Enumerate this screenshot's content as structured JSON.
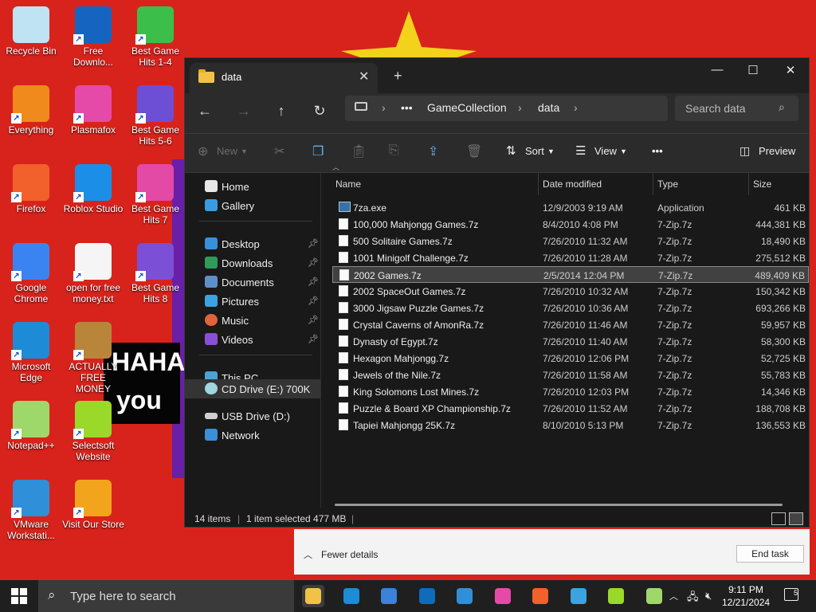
{
  "desktop": {
    "icons": [
      {
        "label": "Recycle Bin",
        "icon": "recycle-bin-icon",
        "color": "#bfe3f2"
      },
      {
        "label": "Free Downlo...",
        "icon": "download-manager-icon",
        "color": "#1565c0"
      },
      {
        "label": "Best Game Hits 1-4",
        "icon": "dice-icon",
        "color": "#3bbf4a"
      },
      {
        "label": "Everything",
        "icon": "magnifier-icon",
        "color": "#f08a1c"
      },
      {
        "label": "Plasmafox",
        "icon": "plasmafox-icon",
        "color": "#e64aa8"
      },
      {
        "label": "Best Game Hits 5-6",
        "icon": "dice-icon",
        "color": "#6d4fd6"
      },
      {
        "label": "Firefox",
        "icon": "firefox-icon",
        "color": "#f2602c"
      },
      {
        "label": "Roblox Studio",
        "icon": "roblox-studio-icon",
        "color": "#1b8fe8"
      },
      {
        "label": "Best Game Hits 7",
        "icon": "dice-icon",
        "color": "#e34aa5"
      },
      {
        "label": "Google Chrome",
        "icon": "chrome-icon",
        "color": "#3a84f2"
      },
      {
        "label": "open for free money.txt",
        "icon": "text-file-icon",
        "color": "#f5f5f5"
      },
      {
        "label": "Best Game Hits 8",
        "icon": "dice-icon",
        "color": "#7b4fd6"
      },
      {
        "label": "Microsoft Edge",
        "icon": "edge-icon",
        "color": "#1d8bd6"
      },
      {
        "label": "ACTUALLY FREE MONEY",
        "icon": "money-bag-icon",
        "color": "#b9853a"
      },
      {
        "label": "Notepad++",
        "icon": "notepad-plus-icon",
        "color": "#9fd86a"
      },
      {
        "label": "Selectsoft Website",
        "icon": "selectsoft-icon",
        "color": "#9ad82a"
      },
      {
        "label": "VMware Workstati...",
        "icon": "vmware-icon",
        "color": "#2f8fd8"
      },
      {
        "label": "Visit Our Store",
        "icon": "store-icon",
        "color": "#f2a51c"
      }
    ],
    "overlay_text": [
      "HAHA",
      "you"
    ]
  },
  "explorer": {
    "tab_title": "data",
    "breadcrumb": [
      "GameCollection",
      "data"
    ],
    "search_placeholder": "Search data",
    "toolbar": {
      "new": "New",
      "sort": "Sort",
      "view": "View",
      "more": "•••",
      "preview": "Preview"
    },
    "sidebar": {
      "home": "Home",
      "gallery": "Gallery",
      "desktop": "Desktop",
      "downloads": "Downloads",
      "documents": "Documents",
      "pictures": "Pictures",
      "music": "Music",
      "videos": "Videos",
      "this_pc": "This PC",
      "cd_drive": "CD Drive (E:) 700K",
      "usb_drive": "USB Drive (D:)",
      "network": "Network"
    },
    "columns": {
      "name": "Name",
      "date": "Date modified",
      "type": "Type",
      "size": "Size"
    },
    "files": [
      {
        "name": "7za.exe",
        "date": "12/9/2003 9:19 AM",
        "type": "Application",
        "size": "461 KB"
      },
      {
        "name": "100,000 Mahjongg Games.7z",
        "date": "8/4/2010 4:08 PM",
        "type": "7-Zip.7z",
        "size": "444,381 KB"
      },
      {
        "name": "500 Solitaire Games.7z",
        "date": "7/26/2010 11:32 AM",
        "type": "7-Zip.7z",
        "size": "18,490 KB"
      },
      {
        "name": "1001 Minigolf Challenge.7z",
        "date": "7/26/2010 11:28 AM",
        "type": "7-Zip.7z",
        "size": "275,512 KB"
      },
      {
        "name": "2002 Games.7z",
        "date": "2/5/2014 12:04 PM",
        "type": "7-Zip.7z",
        "size": "489,409 KB"
      },
      {
        "name": "2002 SpaceOut Games.7z",
        "date": "7/26/2010 10:32 AM",
        "type": "7-Zip.7z",
        "size": "150,342 KB"
      },
      {
        "name": "3000 Jigsaw Puzzle Games.7z",
        "date": "7/26/2010 10:36 AM",
        "type": "7-Zip.7z",
        "size": "693,266 KB"
      },
      {
        "name": "Crystal Caverns of AmonRa.7z",
        "date": "7/26/2010 11:46 AM",
        "type": "7-Zip.7z",
        "size": "59,957 KB"
      },
      {
        "name": "Dynasty of Egypt.7z",
        "date": "7/26/2010 11:40 AM",
        "type": "7-Zip.7z",
        "size": "58,300 KB"
      },
      {
        "name": "Hexagon Mahjongg.7z",
        "date": "7/26/2010 12:06 PM",
        "type": "7-Zip.7z",
        "size": "52,725 KB"
      },
      {
        "name": "Jewels of the Nile.7z",
        "date": "7/26/2010 11:58 AM",
        "type": "7-Zip.7z",
        "size": "55,783 KB"
      },
      {
        "name": "King Solomons Lost Mines.7z",
        "date": "7/26/2010 12:03 PM",
        "type": "7-Zip.7z",
        "size": "14,346 KB"
      },
      {
        "name": "Puzzle & Board XP Championship.7z",
        "date": "7/26/2010 11:52 AM",
        "type": "7-Zip.7z",
        "size": "188,708 KB"
      },
      {
        "name": "Tapiei Mahjongg 25K.7z",
        "date": "8/10/2010 5:13 PM",
        "type": "7-Zip.7z",
        "size": "136,553 KB"
      }
    ],
    "selected_file": "2002 Games.7z",
    "status": {
      "items": "14 items",
      "selected": "1 item selected  477 MB"
    }
  },
  "task_manager": {
    "fewer_details": "Fewer details",
    "end_task": "End task"
  },
  "taskbar": {
    "search_placeholder": "Type here to search",
    "apps": [
      "file-explorer-icon",
      "edge-icon",
      "store-icon",
      "outlook-icon",
      "vmware-icon",
      "plasmafox-icon",
      "firefox-icon",
      "photos-icon",
      "selectsoft-icon",
      "notepad-plus-icon"
    ],
    "time": "9:11 PM",
    "date": "12/21/2024",
    "notifications": "5"
  }
}
